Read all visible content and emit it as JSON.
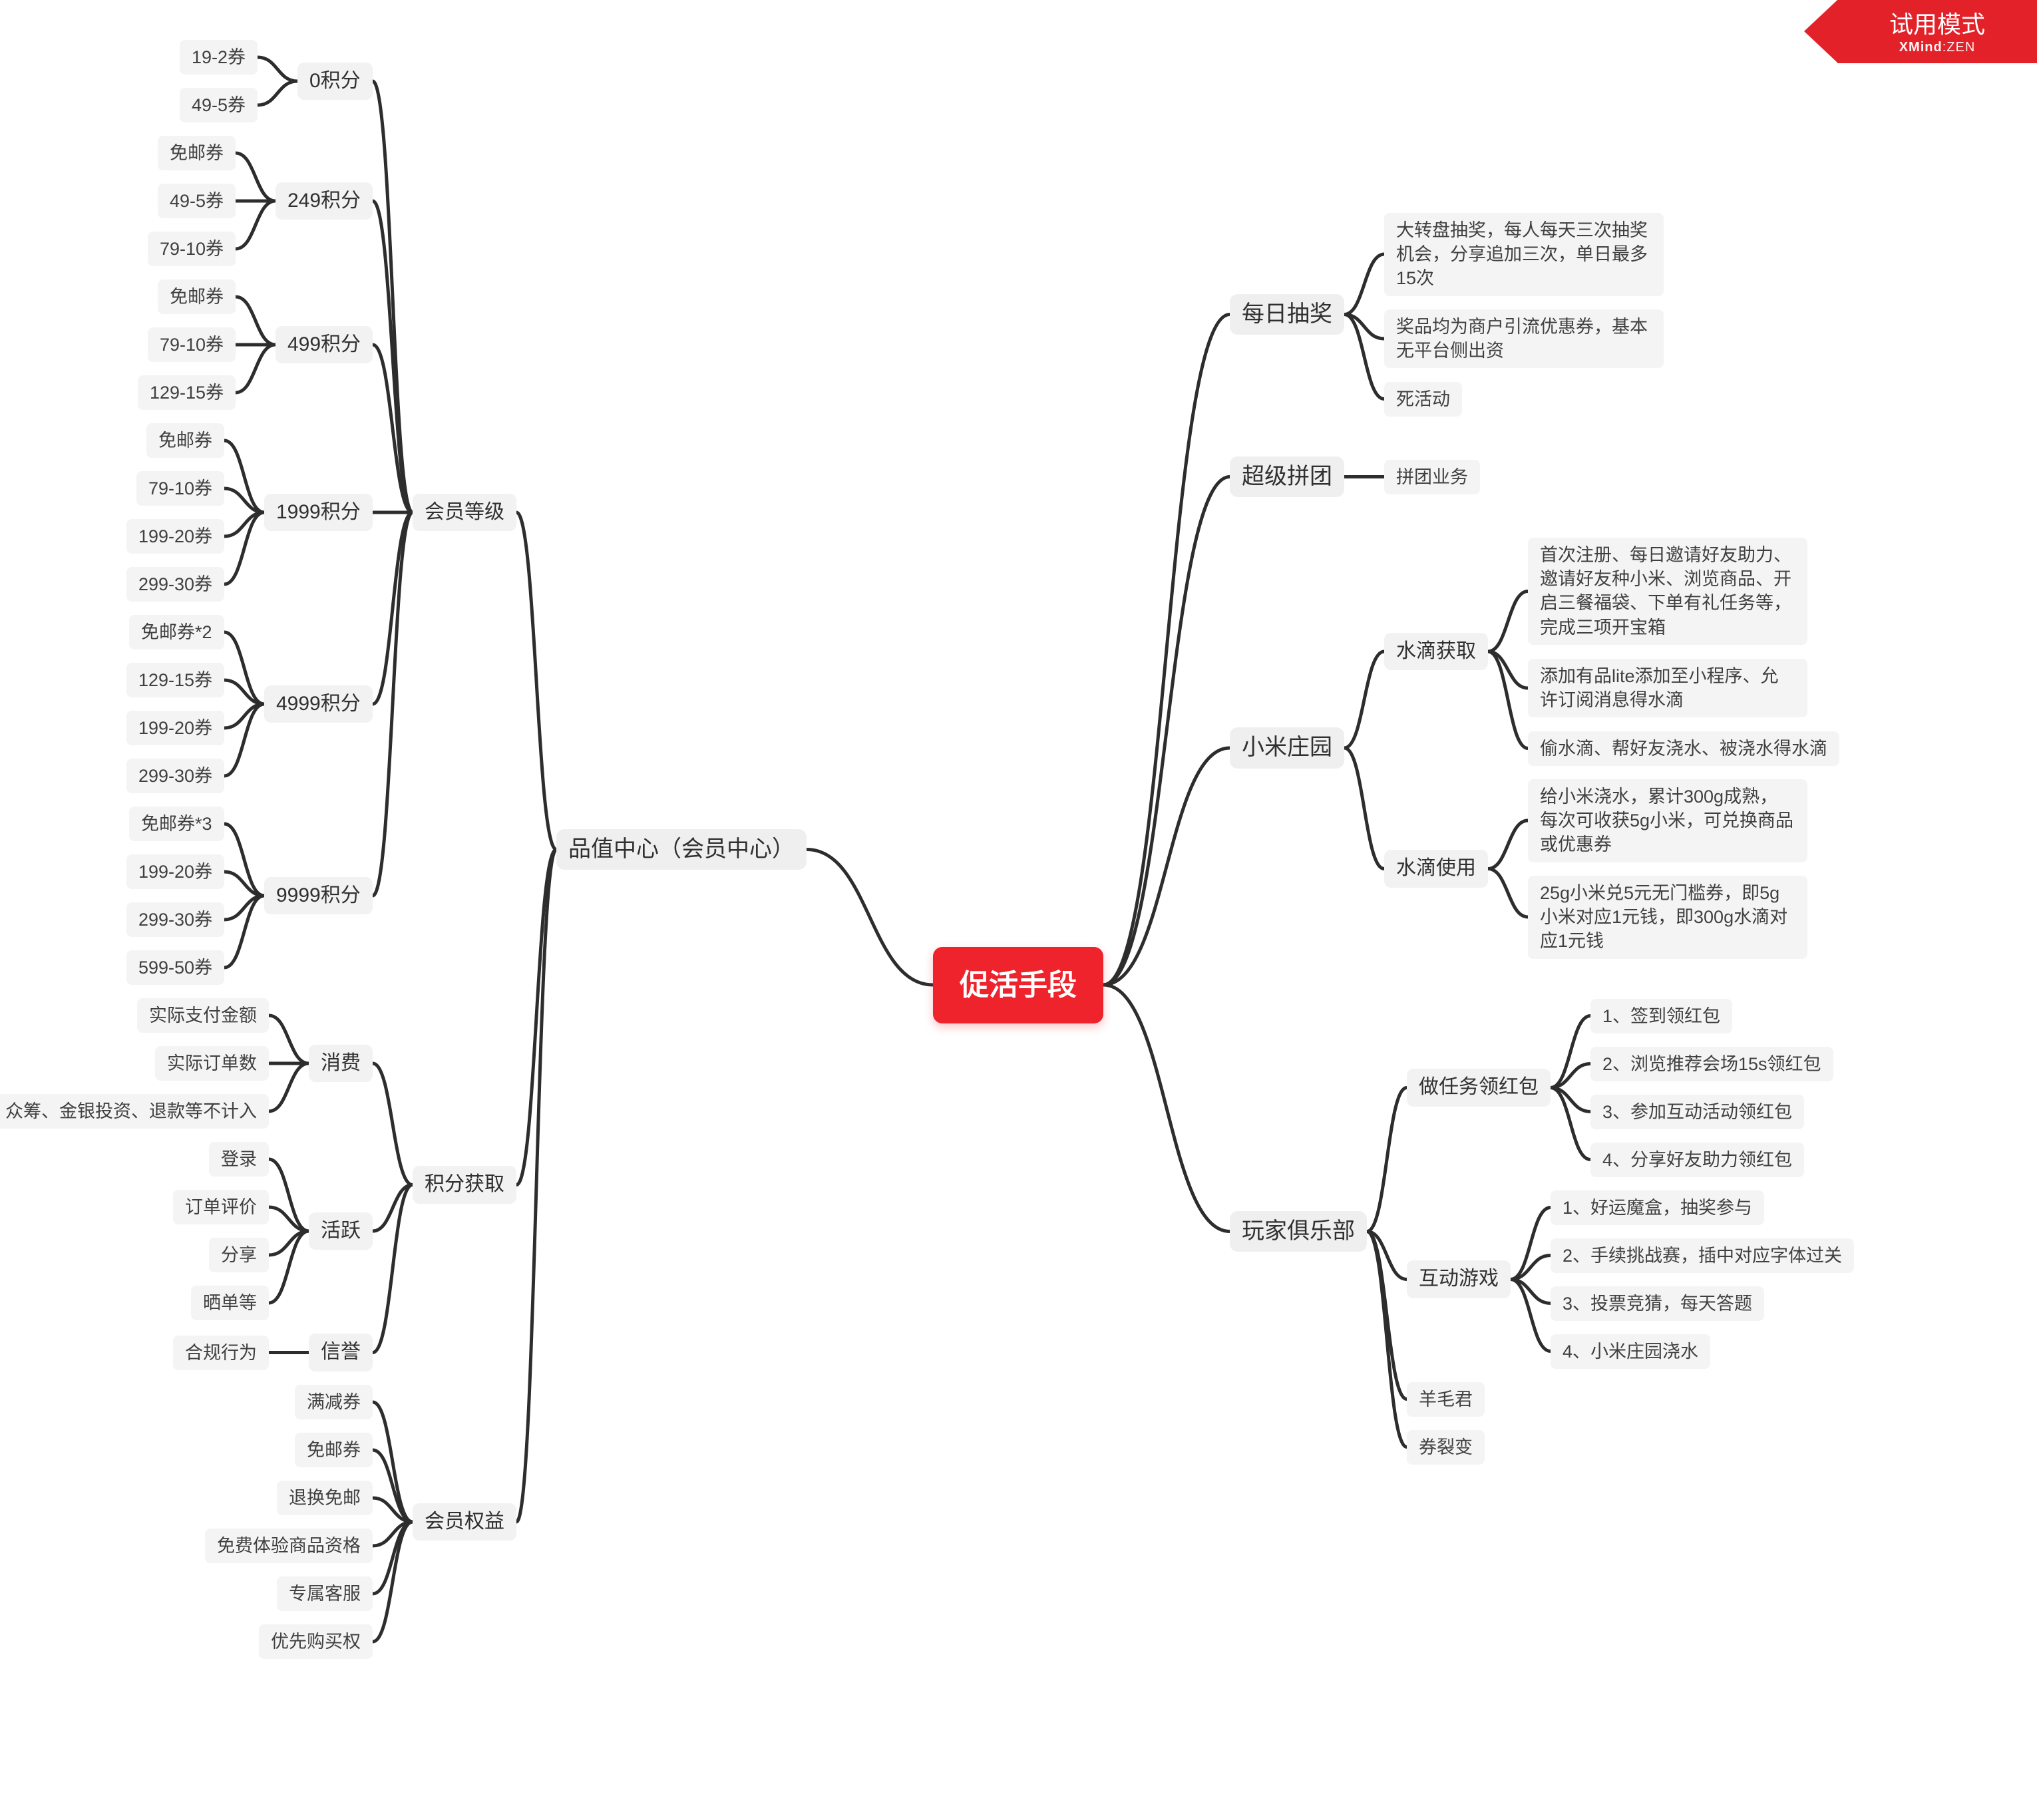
{
  "ribbon": {
    "title": "试用模式",
    "sub_brand": "XMind",
    "sub_mode": ":ZEN"
  },
  "root": {
    "label": "促活手段"
  },
  "branches_right": [
    {
      "label": "每日抽奖",
      "children": [
        {
          "label": "大转盘抽奖，每人每天三次抽奖机会，分享追加三次，单日最多15次",
          "wrap": true
        },
        {
          "label": "奖品均为商户引流优惠券，基本无平台侧出资",
          "wrap": true
        },
        {
          "label": "死活动"
        }
      ]
    },
    {
      "label": "超级拼团",
      "children": [
        {
          "label": "拼团业务"
        }
      ]
    },
    {
      "label": "小米庄园",
      "children": [
        {
          "label": "水滴获取",
          "children": [
            {
              "label": "首次注册、每日邀请好友助力、邀请好友种小米、浏览商品、开启三餐福袋、下单有礼任务等，完成三项开宝箱",
              "wrap": true
            },
            {
              "label": "添加有品lite添加至小程序、允许订阅消息得水滴",
              "wrap": true
            },
            {
              "label": "偷水滴、帮好友浇水、被浇水得水滴"
            }
          ]
        },
        {
          "label": "水滴使用",
          "children": [
            {
              "label": "给小米浇水，累计300g成熟，每次可收获5g小米，可兑换商品或优惠券",
              "wrap": true
            },
            {
              "label": "25g小米兑5元无门槛券，即5g小米对应1元钱，即300g水滴对应1元钱",
              "wrap": true
            }
          ]
        }
      ]
    },
    {
      "label": "玩家俱乐部",
      "children": [
        {
          "label": "做任务领红包",
          "children": [
            {
              "label": "1、签到领红包"
            },
            {
              "label": "2、浏览推荐会场15s领红包"
            },
            {
              "label": "3、参加互动活动领红包"
            },
            {
              "label": "4、分享好友助力领红包"
            }
          ]
        },
        {
          "label": "互动游戏",
          "children": [
            {
              "label": "1、好运魔盒，抽奖参与"
            },
            {
              "label": "2、手续挑战赛，插中对应字体过关"
            },
            {
              "label": "3、投票竞猜，每天答题"
            },
            {
              "label": "4、小米庄园浇水"
            }
          ]
        },
        {
          "label": "羊毛君"
        },
        {
          "label": "券裂变"
        }
      ]
    }
  ],
  "branch_left": {
    "label": "品值中心（会员中心）",
    "children": [
      {
        "label": "会员等级",
        "children": [
          {
            "label": "0积分",
            "children": [
              {
                "label": "19-2券"
              },
              {
                "label": "49-5券"
              }
            ]
          },
          {
            "label": "249积分",
            "children": [
              {
                "label": "免邮券"
              },
              {
                "label": "49-5券"
              },
              {
                "label": "79-10券"
              }
            ]
          },
          {
            "label": "499积分",
            "children": [
              {
                "label": "免邮券"
              },
              {
                "label": "79-10券"
              },
              {
                "label": "129-15券"
              }
            ]
          },
          {
            "label": "1999积分",
            "children": [
              {
                "label": "免邮券"
              },
              {
                "label": "79-10券"
              },
              {
                "label": "199-20券"
              },
              {
                "label": "299-30券"
              }
            ]
          },
          {
            "label": "4999积分",
            "children": [
              {
                "label": "免邮券*2"
              },
              {
                "label": "129-15券"
              },
              {
                "label": "199-20券"
              },
              {
                "label": "299-30券"
              }
            ]
          },
          {
            "label": "9999积分",
            "children": [
              {
                "label": "免邮券*3"
              },
              {
                "label": "199-20券"
              },
              {
                "label": "299-30券"
              },
              {
                "label": "599-50券"
              }
            ]
          }
        ]
      },
      {
        "label": "积分获取",
        "children": [
          {
            "label": "消费",
            "children": [
              {
                "label": "实际支付金额"
              },
              {
                "label": "实际订单数"
              },
              {
                "label": "众筹、金银投资、退款等不计入"
              }
            ]
          },
          {
            "label": "活跃",
            "children": [
              {
                "label": "登录"
              },
              {
                "label": "订单评价"
              },
              {
                "label": "分享"
              },
              {
                "label": "晒单等"
              }
            ]
          },
          {
            "label": "信誉",
            "children": [
              {
                "label": "合规行为"
              }
            ]
          }
        ]
      },
      {
        "label": "会员权益",
        "children": [
          {
            "label": "满减券"
          },
          {
            "label": "免邮券"
          },
          {
            "label": "退换免邮"
          },
          {
            "label": "免费体验商品资格"
          },
          {
            "label": "专属客服"
          },
          {
            "label": "优先购买权"
          }
        ]
      }
    ]
  }
}
